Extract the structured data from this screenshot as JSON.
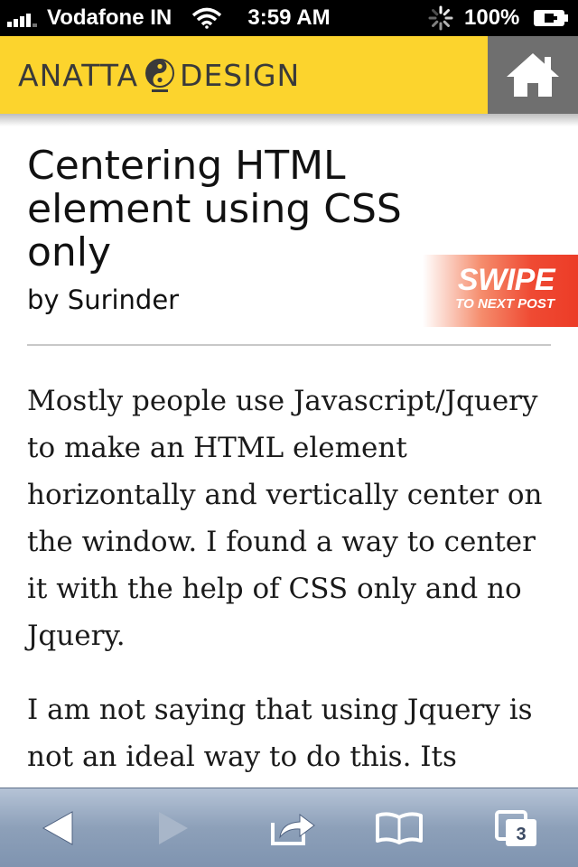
{
  "status_bar": {
    "carrier": "Vodafone IN",
    "time": "3:59 AM",
    "battery": "100%",
    "icons": [
      "signal-icon",
      "wifi-icon",
      "activity-spinner-icon",
      "battery-icon"
    ]
  },
  "header": {
    "logo_left": "ANATTA",
    "logo_right": "DESIGN",
    "brand_color": "#fcd42d",
    "home_icon": "home-icon"
  },
  "post": {
    "title": "Centering HTML element using CSS only",
    "author": "by Surinder",
    "swipe_badge": {
      "big": "SWIPE",
      "small": "TO NEXT POST"
    },
    "paragraphs": [
      "Mostly people use Javascript/Jquery to make an HTML element horizontally and vertically center on the window. I found a way to center it with the help of CSS only and no Jquery.",
      "I am not saying that using Jquery is not an ideal way to do this. Its"
    ]
  },
  "toolbar": {
    "icons": [
      "back-icon",
      "forward-icon",
      "share-icon",
      "bookmarks-icon",
      "tabs-icon"
    ],
    "tabs_count": "3"
  }
}
